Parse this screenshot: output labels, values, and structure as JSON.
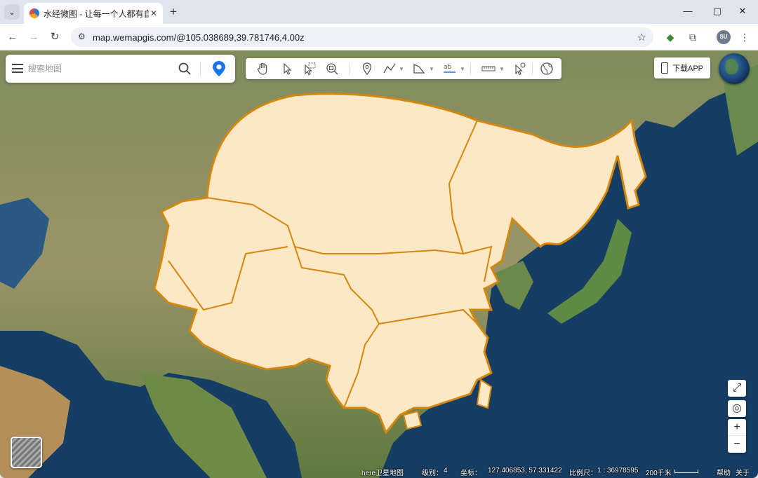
{
  "browser": {
    "tab_title": "水经微图 - 让每一个人都有自己",
    "url": "map.wemapgis.com/@105.038689,39.781746,4.00z",
    "profile_initials": "SU"
  },
  "search": {
    "placeholder": "搜索地图"
  },
  "toolbar_icons": [
    "pan-hand-icon",
    "select-icon",
    "box-select-icon",
    "zoom-area-icon",
    "marker-icon",
    "polyline-icon",
    "polygon-icon",
    "text-label-icon",
    "measure-ruler-icon",
    "info-pointer-icon",
    "globe-tool-icon"
  ],
  "download_app": "下载APP",
  "status": {
    "basemap": "here卫星地图",
    "level_label": "级别：",
    "level_value": "4",
    "coord_label": "坐标：",
    "coord_value": "127.406853, 57.331422",
    "scale_label": "比例尺：",
    "scale_value": "1 : 36978595",
    "scale_bar_label": "200千米",
    "help": "帮助",
    "about": "关于"
  },
  "colors": {
    "region_fill": "#fde8c5",
    "region_border": "#d4870f",
    "sea": "#163d63",
    "land": "#7a8a5a",
    "accent": "#1a73e8"
  }
}
